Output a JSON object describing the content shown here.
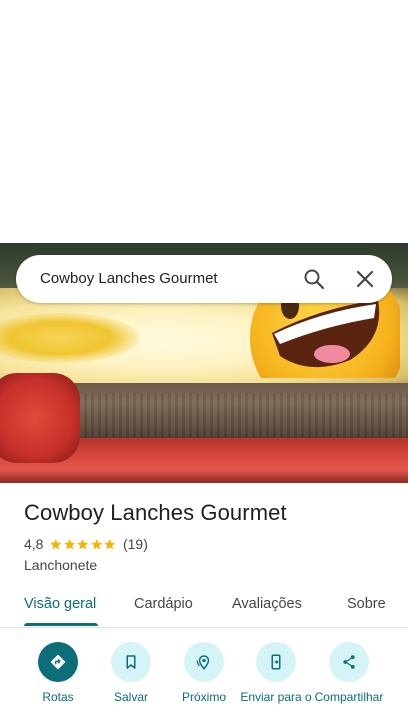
{
  "search": {
    "query": "Cowboy Lanches Gourmet"
  },
  "place": {
    "name": "Cowboy Lanches Gourmet",
    "rating": "4,8",
    "stars": 5,
    "review_count": "(19)",
    "category": "Lanchonete"
  },
  "tabs": [
    {
      "label": "Visão geral",
      "active": true
    },
    {
      "label": "Cardápio",
      "active": false
    },
    {
      "label": "Avaliações",
      "active": false
    },
    {
      "label": "Sobre",
      "active": false
    }
  ],
  "actions": [
    {
      "label": "Rotas",
      "icon": "directions-icon",
      "primary": true
    },
    {
      "label": "Salvar",
      "icon": "bookmark-icon",
      "primary": false
    },
    {
      "label": "Próximo",
      "icon": "nearby-icon",
      "primary": false
    },
    {
      "label": "Enviar para o",
      "icon": "send-to-phone-icon",
      "primary": false
    },
    {
      "label": "Compartilhar",
      "icon": "share-icon",
      "primary": false
    }
  ],
  "colors": {
    "accent": "#0b6e78",
    "action_bg": "#d5f4f7",
    "star": "#f4b400"
  }
}
